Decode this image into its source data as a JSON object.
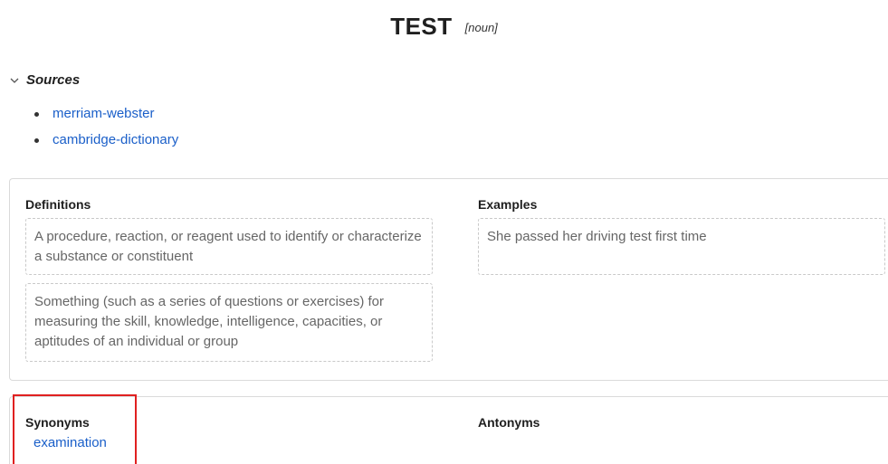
{
  "entry": {
    "word": "TEST",
    "part_of_speech": "[noun]"
  },
  "sources": {
    "label": "Sources",
    "items": [
      "merriam-webster",
      "cambridge-dictionary"
    ]
  },
  "definitions": {
    "heading": "Definitions",
    "items": [
      "A procedure, reaction, or reagent used to identify or characterize a substance or constituent",
      "Something (such as a series of questions or exercises) for measuring the skill, knowledge, intelligence, capacities, or aptitudes of an individual or group"
    ]
  },
  "examples": {
    "heading": "Examples",
    "items": [
      "She passed her driving test first time"
    ]
  },
  "synonyms": {
    "heading": "Synonyms",
    "items": [
      "examination"
    ]
  },
  "antonyms": {
    "heading": "Antonyms",
    "items": []
  },
  "colors": {
    "link": "#1a5fc9",
    "highlight": "#e02020"
  },
  "icons": {
    "sources_toggle": "chevron-down-icon"
  }
}
